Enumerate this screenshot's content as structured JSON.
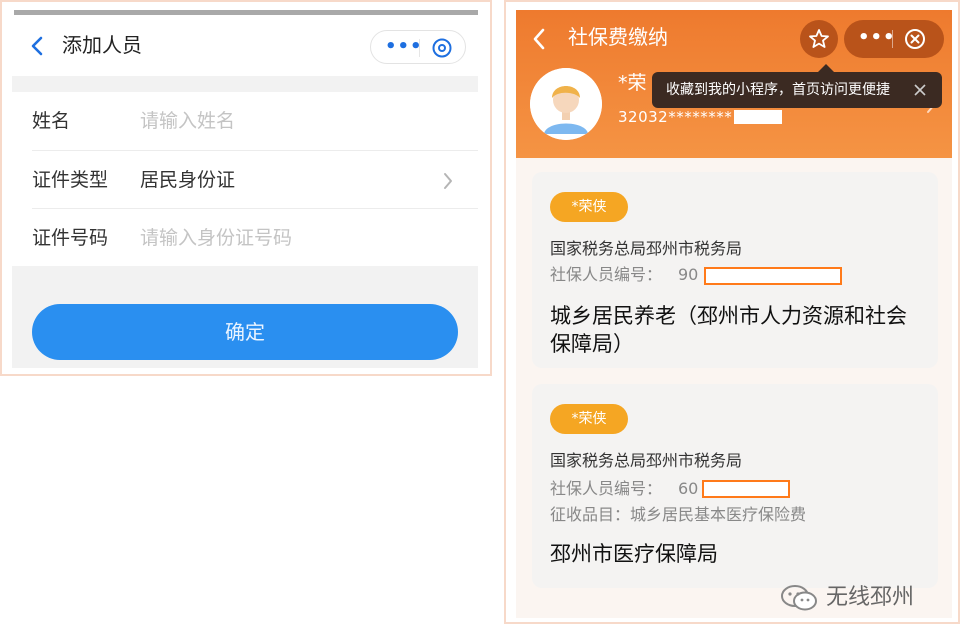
{
  "left_screen": {
    "nav_title": "添加人员",
    "rows": [
      {
        "label": "姓名",
        "placeholder": "请输入姓名"
      },
      {
        "label": "证件类型",
        "value": "居民身份证"
      },
      {
        "label": "证件号码",
        "placeholder": "请输入身份证号码"
      }
    ],
    "confirm_label": "确定",
    "accent_color": "#2a8ff0"
  },
  "right_screen": {
    "nav_title": "社保费缴纳",
    "user": {
      "name": "*荣",
      "id_partial": "32032********"
    },
    "tooltip": "收藏到我的小程序，首页访问更便捷",
    "brand_color": "#ef7d31",
    "cards": [
      {
        "tag": "*荣侠",
        "tax_office": "国家税务总局邳州市税务局",
        "member_no_label": "社保人员编号：",
        "member_no_partial": "90",
        "item": "城乡居民养老（邳州市人力资源和社会保障局）"
      },
      {
        "tag": "*荣侠",
        "tax_office": "国家税务总局邳州市税务局",
        "member_no_label": "社保人员编号：",
        "member_no_partial": "60",
        "levy_item": "征收品目：城乡居民基本医疗保险费",
        "item": "邳州市医疗保障局"
      }
    ]
  },
  "watermark": "无线邳州"
}
